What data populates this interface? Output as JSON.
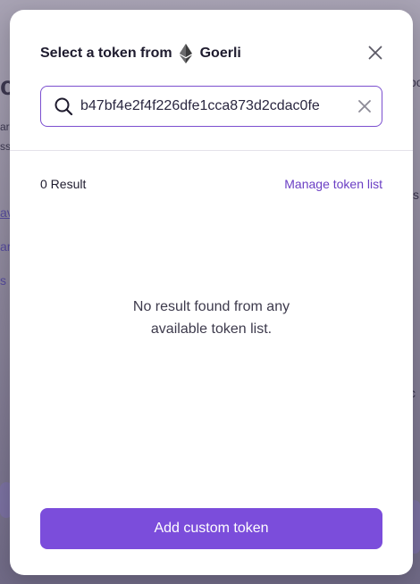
{
  "background": {
    "fragments": [
      "c",
      "ar",
      "ss",
      "av",
      "ar",
      "s",
      "oo",
      "sh",
      "i c"
    ]
  },
  "modal": {
    "title": "Select a token from",
    "network": "Goerli",
    "network_icon": "ethereum-icon",
    "close_icon": "close-icon"
  },
  "search": {
    "value": "b47bf4e2f4f226dfe1cca873d2cdac0fe",
    "icon": "search-icon",
    "clear_icon": "clear-icon"
  },
  "results": {
    "count_label": "0 Result",
    "manage_label": "Manage token list",
    "empty_line1": "No result found from any",
    "empty_line2": "available token list."
  },
  "footer": {
    "add_button_label": "Add custom token"
  },
  "colors": {
    "accent": "#7b4ddb",
    "link": "#6b3fc4",
    "input_border": "#7b4fcf"
  }
}
